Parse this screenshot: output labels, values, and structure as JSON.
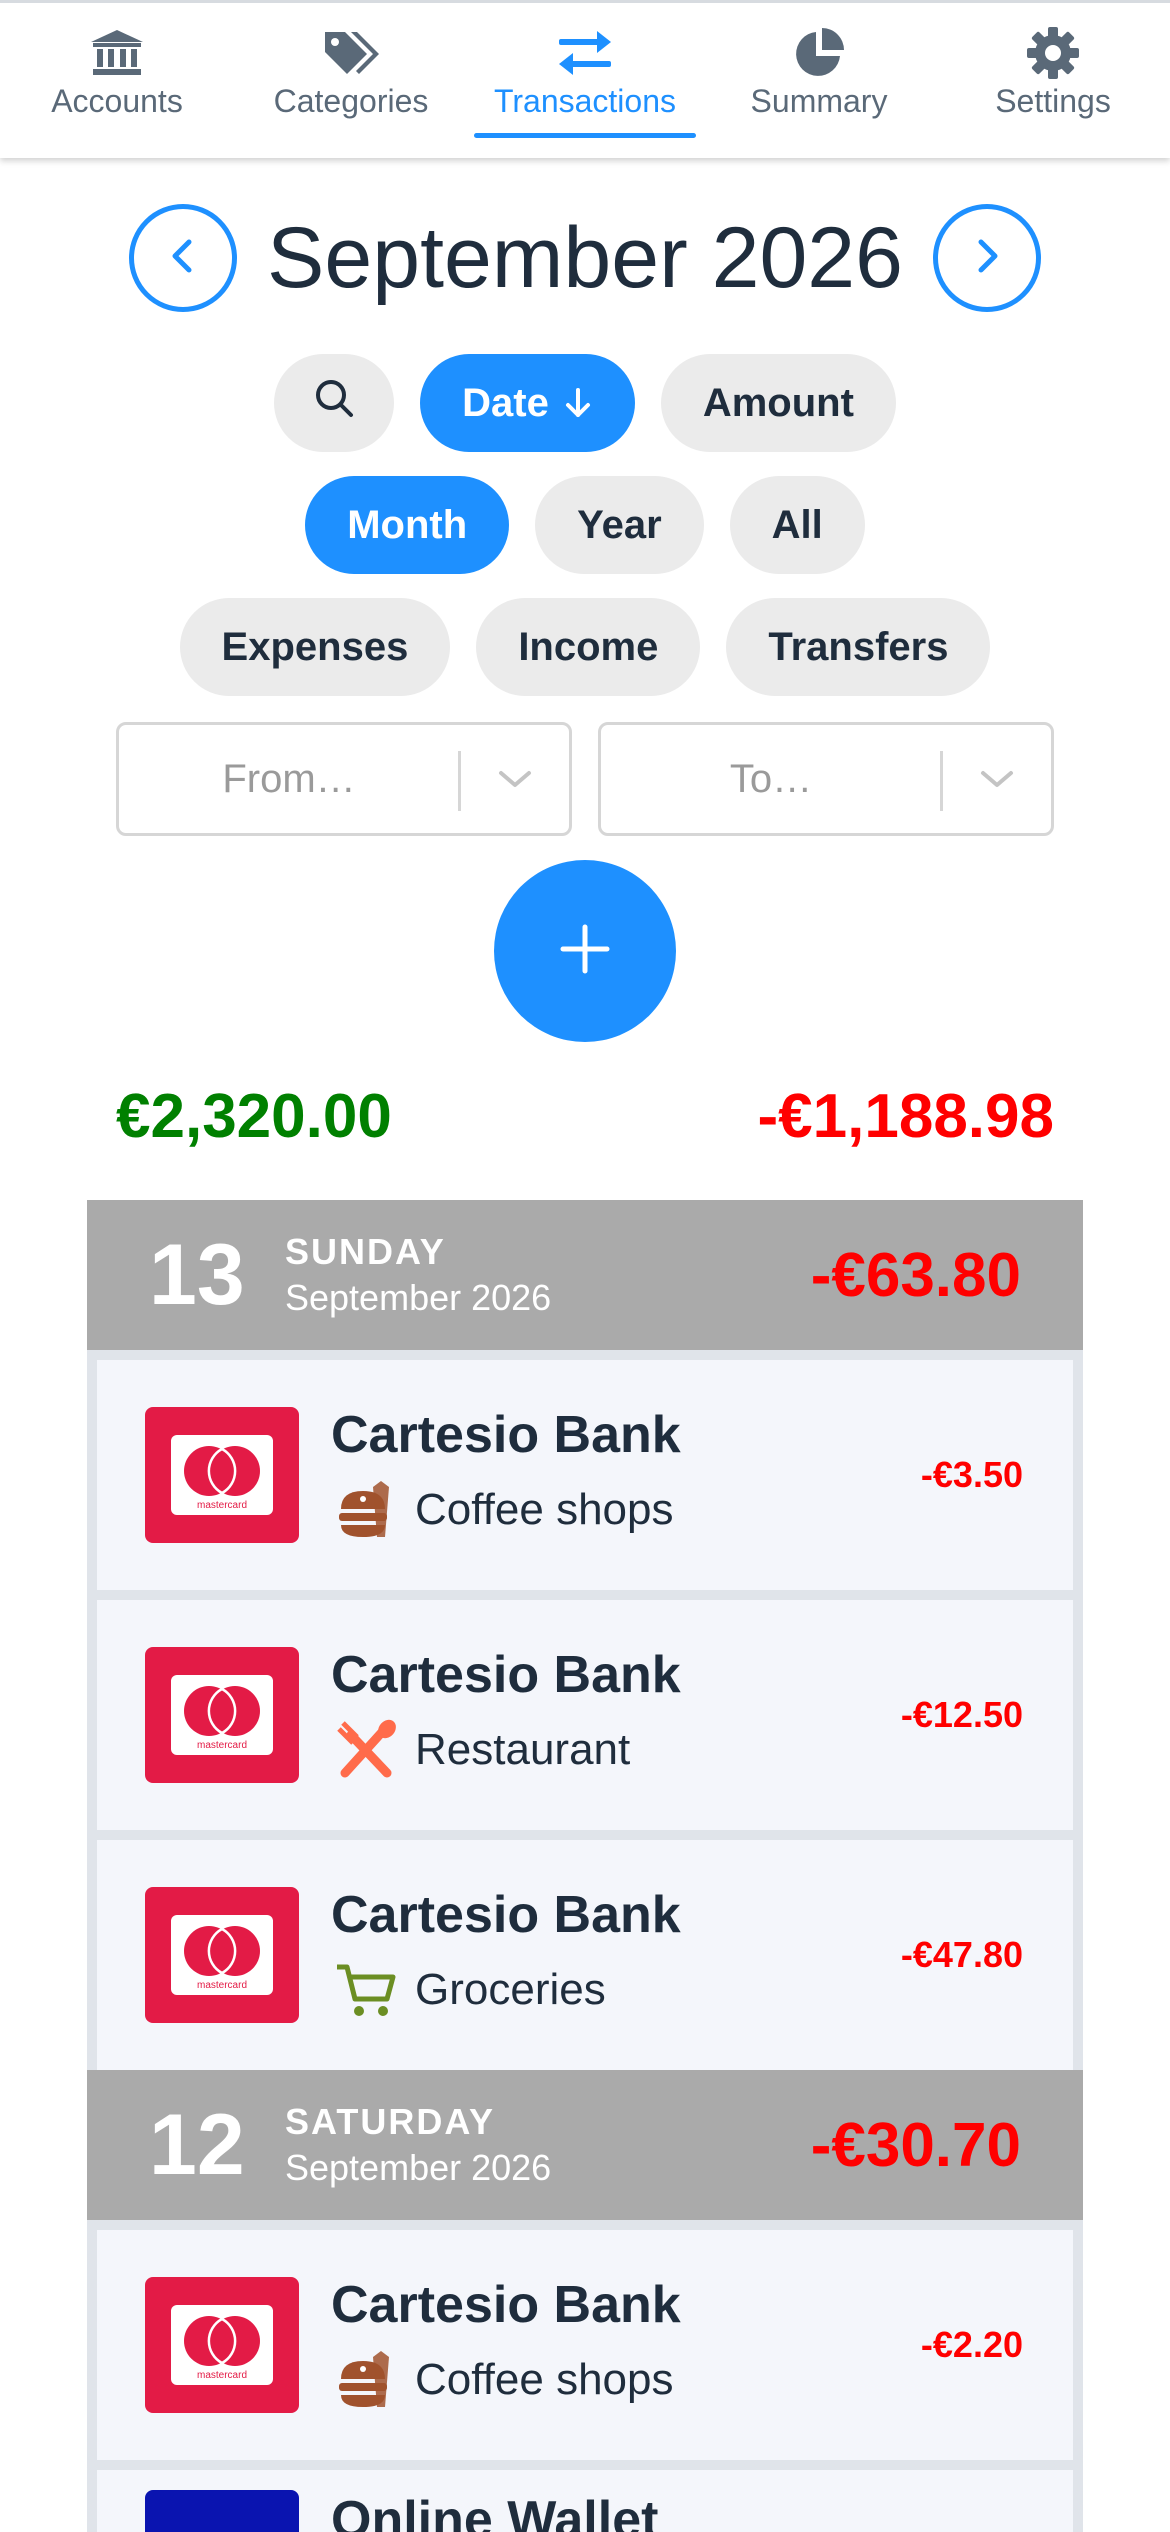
{
  "nav": {
    "tabs": [
      {
        "label": "Accounts",
        "icon": "bank-icon"
      },
      {
        "label": "Categories",
        "icon": "tags-icon"
      },
      {
        "label": "Transactions",
        "icon": "transfer-arrows-icon",
        "active": true
      },
      {
        "label": "Summary",
        "icon": "pie-chart-icon"
      },
      {
        "label": "Settings",
        "icon": "gear-icon"
      }
    ]
  },
  "period": {
    "title": "September 2026"
  },
  "sort": {
    "date_label": "Date",
    "amount_label": "Amount",
    "active": "Date"
  },
  "range": {
    "month_label": "Month",
    "year_label": "Year",
    "all_label": "All",
    "active": "Month"
  },
  "type_filter": {
    "expenses_label": "Expenses",
    "income_label": "Income",
    "transfers_label": "Transfers"
  },
  "account_filter": {
    "from_placeholder": "From…",
    "to_placeholder": "To…"
  },
  "totals": {
    "income": "€2,320.00",
    "expenses": "-€1,188.98"
  },
  "colors": {
    "accent": "#1e90ff",
    "income": "#008000",
    "expense": "#ff0000",
    "mastercard": "#e31b46",
    "day_header": "#aaaaaa"
  },
  "days": [
    {
      "day": "13",
      "weekday": "SUNDAY",
      "month": "September 2026",
      "total": "-€63.80",
      "transactions": [
        {
          "account": "Cartesio Bank",
          "category": "Coffee shops",
          "category_icon": "coffee-icon",
          "amount": "-€3.50"
        },
        {
          "account": "Cartesio Bank",
          "category": "Restaurant",
          "category_icon": "fork-knife-icon",
          "amount": "-€12.50"
        },
        {
          "account": "Cartesio Bank",
          "category": "Groceries",
          "category_icon": "cart-icon",
          "amount": "-€47.80"
        }
      ]
    },
    {
      "day": "12",
      "weekday": "SATURDAY",
      "month": "September 2026",
      "total": "-€30.70",
      "transactions": [
        {
          "account": "Cartesio Bank",
          "category": "Coffee shops",
          "category_icon": "coffee-icon",
          "amount": "-€2.20"
        },
        {
          "account": "Online Wallet",
          "partial": true
        }
      ]
    }
  ],
  "card_brand": "mastercard"
}
